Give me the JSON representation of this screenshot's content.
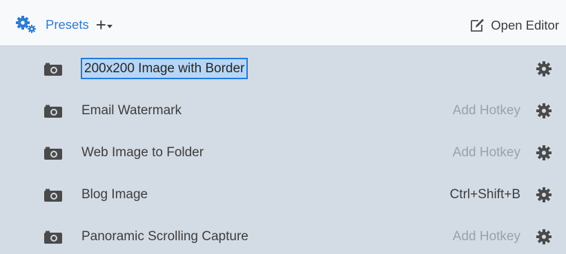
{
  "header": {
    "presets_label": "Presets",
    "add_label": "+",
    "open_editor_label": "Open Editor",
    "icons": {
      "presets": "gears-icon",
      "add": "plus-icon",
      "add_menu": "caret-down-icon",
      "open_editor": "edit-icon"
    }
  },
  "presets": [
    {
      "name": "200x200 Image with Border",
      "hotkey": "",
      "hotkey_is_set": false,
      "selected": true,
      "icon": "camera-icon"
    },
    {
      "name": "Email Watermark",
      "hotkey": "Add Hotkey",
      "hotkey_is_set": false,
      "selected": false,
      "icon": "camera-icon"
    },
    {
      "name": "Web Image to Folder",
      "hotkey": "Add Hotkey",
      "hotkey_is_set": false,
      "selected": false,
      "icon": "camera-icon"
    },
    {
      "name": "Blog Image",
      "hotkey": "Ctrl+Shift+B",
      "hotkey_is_set": true,
      "selected": false,
      "icon": "camera-icon"
    },
    {
      "name": "Panoramic Scrolling Capture",
      "hotkey": "Add Hotkey",
      "hotkey_is_set": false,
      "selected": false,
      "icon": "camera-icon"
    }
  ],
  "colors": {
    "accent": "#2f7bd1",
    "list_background": "#d3dbe4",
    "header_background": "#f7f9fb",
    "selection_border": "#1f7ae0",
    "selection_fill": "#b7d6f5",
    "muted_text": "#9aa1a9"
  }
}
